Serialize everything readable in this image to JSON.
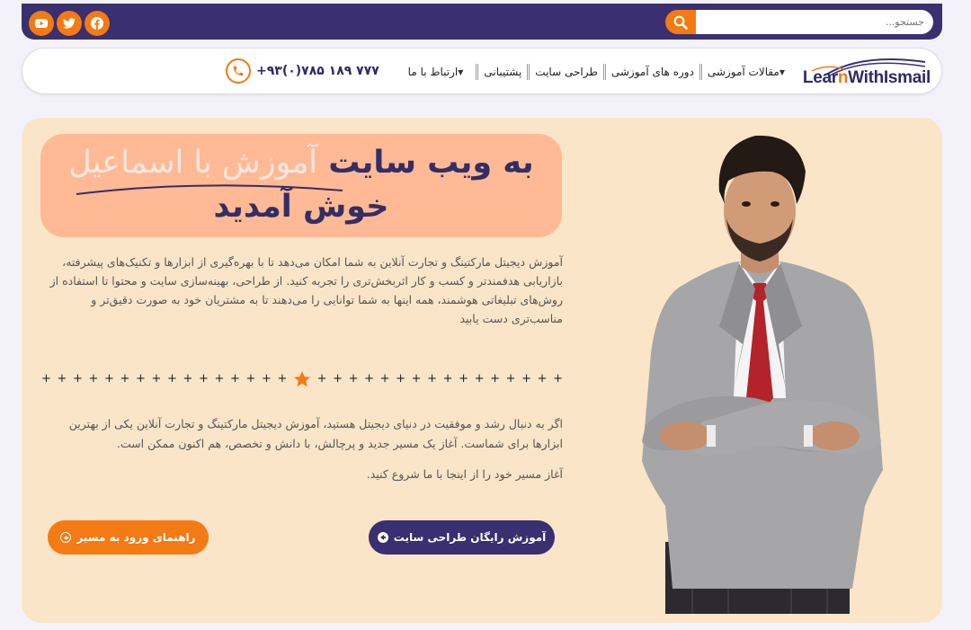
{
  "colors": {
    "accent": "#f47a13",
    "brand_dark": "#3a2f70",
    "hero_bg": "#fbe5c8",
    "headline_bg": "#ffb995"
  },
  "topbar": {
    "social": [
      {
        "icon": "youtube-icon"
      },
      {
        "icon": "twitter-icon"
      },
      {
        "icon": "facebook-icon"
      }
    ],
    "search": {
      "placeholder": "جستجو...",
      "icon": "search-icon"
    }
  },
  "nav": {
    "logo": {
      "text_a": "Lear",
      "text_w": "n",
      "text_b": "WithIsmail"
    },
    "items": [
      {
        "label": "مقالات آموزشی",
        "dropdown": true
      },
      {
        "label": "دوره های آموزشی",
        "dropdown": false
      },
      {
        "label": "طراحی سایت",
        "dropdown": false
      },
      {
        "label": "پشتیبانی",
        "dropdown": false
      },
      {
        "label": "ارتباط با ما",
        "dropdown": true
      }
    ],
    "phone": {
      "number": "+۹۳(۰)۷۸۵ ۱۸۹ ۷۷۷",
      "icon": "phone-icon"
    }
  },
  "hero": {
    "headline": {
      "line1_dark": "به ویب سایت",
      "line1_light": "آموزش با اسماعیل",
      "line2": "خوش آمدید"
    },
    "paragraph1": "آموزش دیجیتل مارکتینگ و تجارت آنلاین به شما امکان می‌دهد تا با بهره‌گیری از ابزارها و تکنیک‌های پیشرفته، بازاریابی هدفمندتر و کسب و کار اثربخش‌تری را تجربه کنید. از طراحی، بهینه‌سازی سایت و محتوا تا استفاده از روش‌های تبلیغاتی هوشمند، همه اینها به شما توانایی را می‌دهند تا به مشتریان خود به صورت دقیق‌تر و مناسب‌تری دست یابید",
    "paragraph2": "اگر به دنبال رشد و موفقیت در دنیای دیجیتل هستید، آموزش دیجیتل مارکتینگ و تجارت آنلاین یکی از بهترین ابزارها برای شماست. آغاز یک مسیر جدید و پرچالش، با دانش و تخصص، هم اکنون ممکن است.",
    "paragraph3": "آغاز مسیر خود را از اینجا با ما شروع کنید.",
    "button_primary": "آموزش رایگان طراحی سایت",
    "button_secondary": "راهنمای ورود به مسیر"
  }
}
